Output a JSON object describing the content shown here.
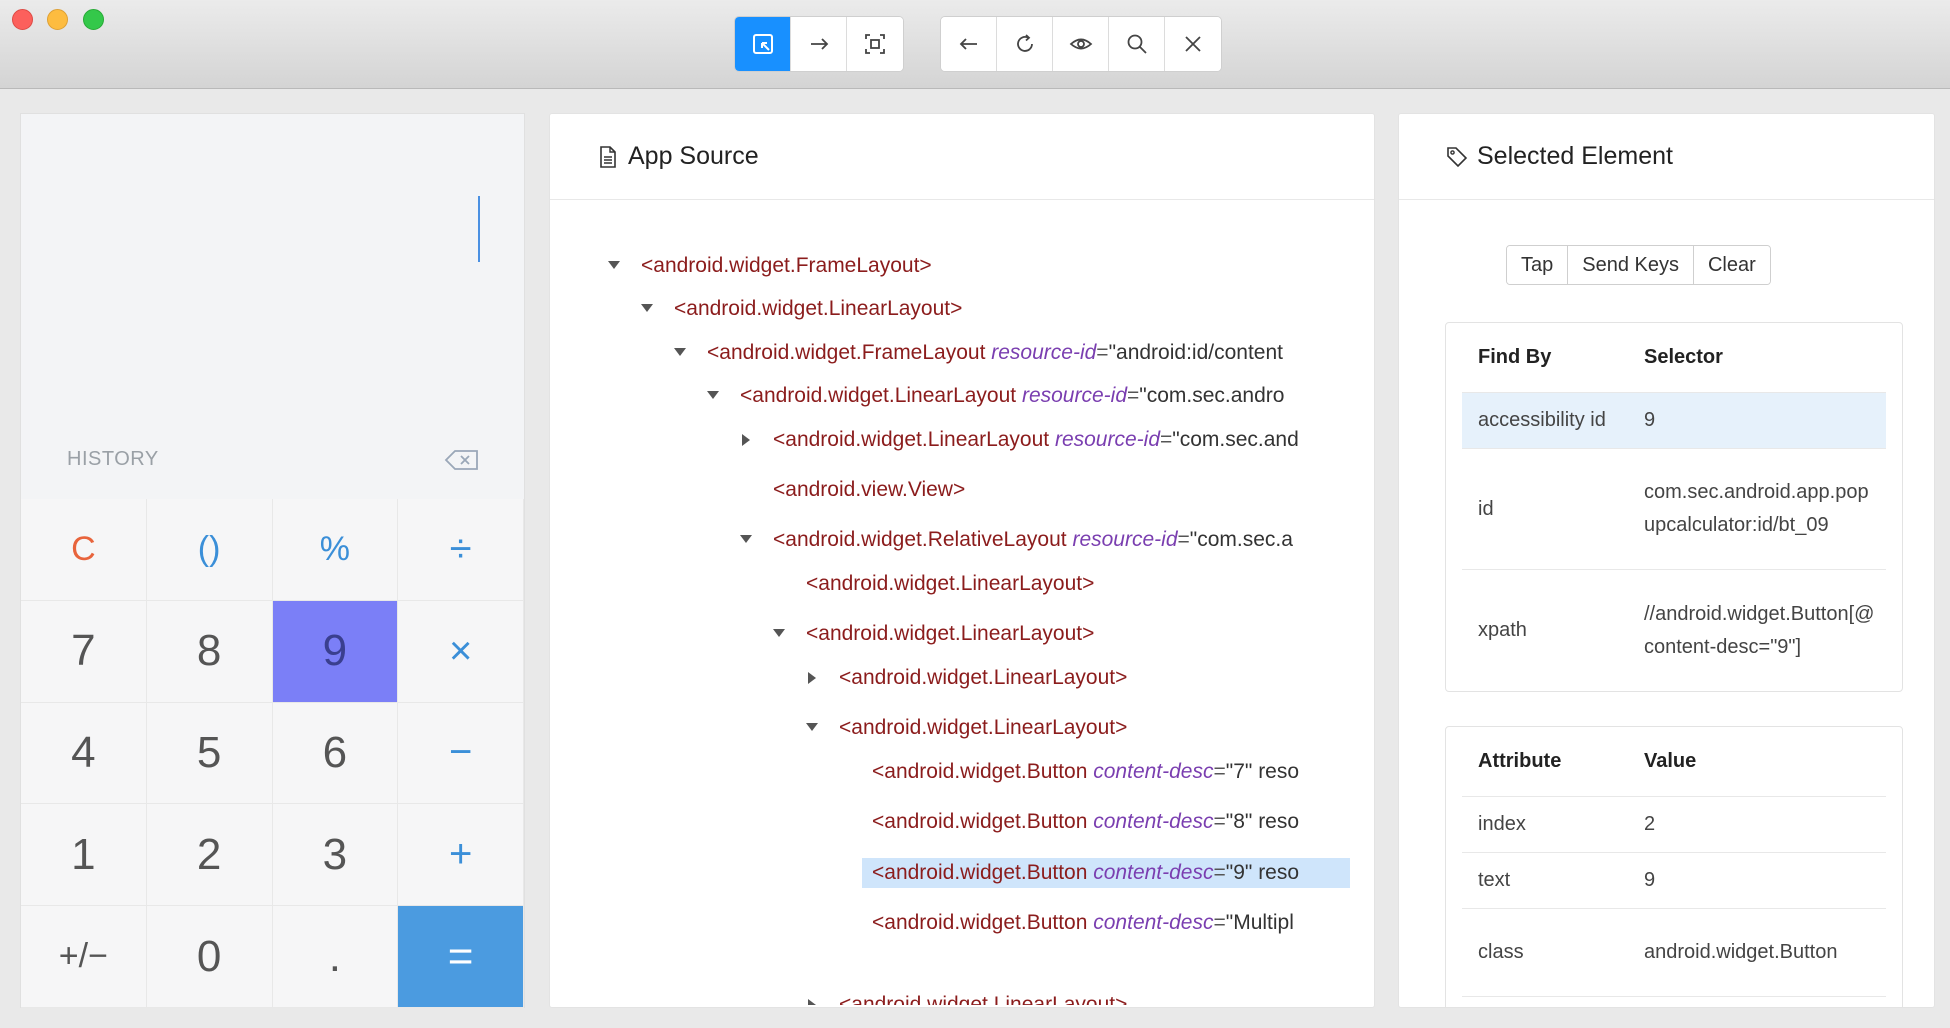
{
  "toolbar": {
    "group1": [
      {
        "icon": "select-element-icon",
        "active": true
      },
      {
        "icon": "swipe-arrow-icon",
        "active": false
      },
      {
        "icon": "tap-by-coordinates-icon",
        "active": false
      }
    ],
    "group2": [
      {
        "icon": "back-arrow-icon"
      },
      {
        "icon": "refresh-icon"
      },
      {
        "icon": "eye-icon"
      },
      {
        "icon": "search-icon"
      },
      {
        "icon": "close-icon"
      }
    ]
  },
  "calculator": {
    "history_label": "HISTORY",
    "keys": [
      "C",
      "()",
      "%",
      "÷",
      "7",
      "8",
      "9",
      "×",
      "4",
      "5",
      "6",
      "−",
      "1",
      "2",
      "3",
      "+",
      "+/−",
      "0",
      ".",
      "="
    ],
    "selected_key": "9"
  },
  "source": {
    "title": "App Source",
    "nodes": [
      {
        "tag": "<android.widget.FrameLayout>",
        "attr": "",
        "eq": "",
        "val": ""
      },
      {
        "tag": "<android.widget.LinearLayout>",
        "attr": "",
        "eq": "",
        "val": ""
      },
      {
        "tag": "<android.widget.FrameLayout ",
        "attr": "resource-id",
        "eq": "=",
        "val": "\"android:id/content"
      },
      {
        "tag": "<android.widget.LinearLayout ",
        "attr": "resource-id",
        "eq": "=",
        "val": "\"com.sec.andro"
      },
      {
        "tag": "<android.widget.LinearLayout ",
        "attr": "resource-id",
        "eq": "=",
        "val": "\"com.sec.and"
      },
      {
        "tag": "<android.view.View>",
        "attr": "",
        "eq": "",
        "val": ""
      },
      {
        "tag": "<android.widget.RelativeLayout ",
        "attr": "resource-id",
        "eq": "=",
        "val": "\"com.sec.a"
      },
      {
        "tag": "<android.widget.LinearLayout>",
        "attr": "",
        "eq": "",
        "val": ""
      },
      {
        "tag": "<android.widget.LinearLayout>",
        "attr": "",
        "eq": "",
        "val": ""
      },
      {
        "tag": "<android.widget.LinearLayout>",
        "attr": "",
        "eq": "",
        "val": ""
      },
      {
        "tag": "<android.widget.LinearLayout>",
        "attr": "",
        "eq": "",
        "val": ""
      },
      {
        "tag": "<android.widget.Button ",
        "attr": "content-desc",
        "eq": "=",
        "val": "\"7\" reso"
      },
      {
        "tag": "<android.widget.Button ",
        "attr": "content-desc",
        "eq": "=",
        "val": "\"8\" reso"
      },
      {
        "tag": "<android.widget.Button ",
        "attr": "content-desc",
        "eq": "=",
        "val": "\"9\" reso"
      },
      {
        "tag": "<android.widget.Button ",
        "attr": "content-desc",
        "eq": "=",
        "val": "\"Multipl"
      },
      {
        "tag": "<android.widget.LinearLayout>",
        "attr": "",
        "eq": "",
        "val": ""
      }
    ]
  },
  "element": {
    "title": "Selected Element",
    "actions": [
      "Tap",
      "Send Keys",
      "Clear"
    ],
    "find_header": {
      "col1": "Find By",
      "col2": "Selector"
    },
    "find_rows": [
      {
        "by": "accessibility id",
        "selector": "9"
      },
      {
        "by": "id",
        "selector": "com.sec.android.app.popupcalculator:id/bt_09"
      },
      {
        "by": "xpath",
        "selector": "//android.widget.Button[@content-desc=\"9\"]"
      }
    ],
    "attr_header": {
      "col1": "Attribute",
      "col2": "Value"
    },
    "attr_rows": [
      {
        "name": "index",
        "value": "2"
      },
      {
        "name": "text",
        "value": "9"
      },
      {
        "name": "class",
        "value": "android.widget.Button"
      }
    ]
  },
  "colors": {
    "accent": "#1890ff",
    "tag": "#8b1c1c",
    "attribute": "#7a3eb0",
    "selected_key": "#7b7ff7",
    "equals_key": "#4b9be0",
    "tree_selection": "#cfe5fb"
  }
}
